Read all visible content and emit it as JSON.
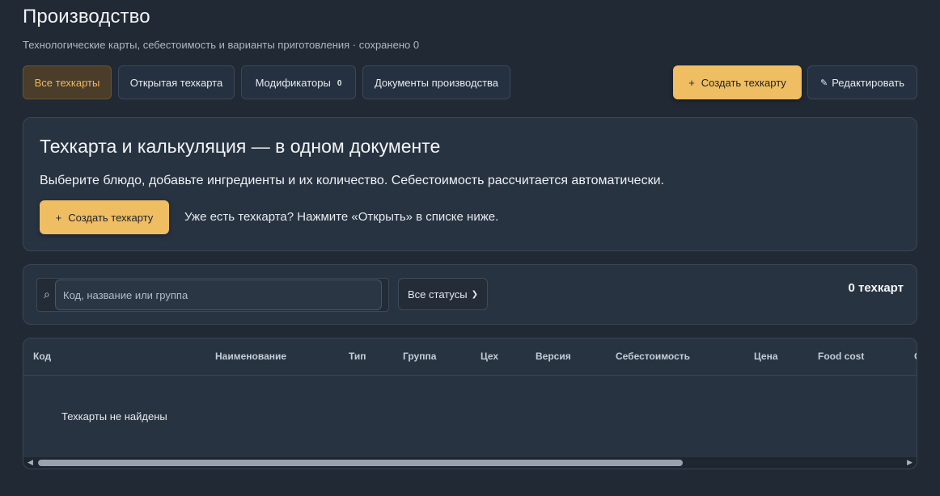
{
  "header": {
    "title": "Производство",
    "subtitle": "Технологические карты, себестоимость и варианты приготовления · сохранено 0"
  },
  "tabs": [
    {
      "label": "Все техкарты",
      "active": true
    },
    {
      "label": "Открытая техкарта",
      "active": false
    },
    {
      "label": "Модификаторы",
      "badge": "0",
      "active": false
    },
    {
      "label": "Документы производства",
      "active": false
    }
  ],
  "toolbar": {
    "create_label": "Создать техкарту",
    "create_icon": "+",
    "edit_label": "Редактировать",
    "edit_icon": "pencil-icon"
  },
  "hero": {
    "title": "Техкарта и калькуляция — в одном документе",
    "text": "Выберите блюдо, добавьте ингредиенты и их количество. Себестоимость рассчитается автоматически.",
    "create_label": "Создать техкарту",
    "create_icon": "+",
    "hint": "Уже есть техкарта? Нажмите «Открыть» в списке ниже."
  },
  "filters": {
    "search_icon": "⌕",
    "search_placeholder": "Код, название или группа",
    "search_value": "",
    "status_selected": "Все статусы",
    "count_label": "0 техкарт"
  },
  "table": {
    "columns": [
      "Код",
      "Наименование",
      "Тип",
      "Группа",
      "Цех",
      "Версия",
      "Себестоимость",
      "Цена",
      "Food cost",
      "С"
    ],
    "empty_message": "Техкарты не найдены"
  },
  "colors": {
    "background": "#212934",
    "card": "#283341",
    "accent": "#efbd62",
    "active_tab_text": "#f0b85a"
  }
}
